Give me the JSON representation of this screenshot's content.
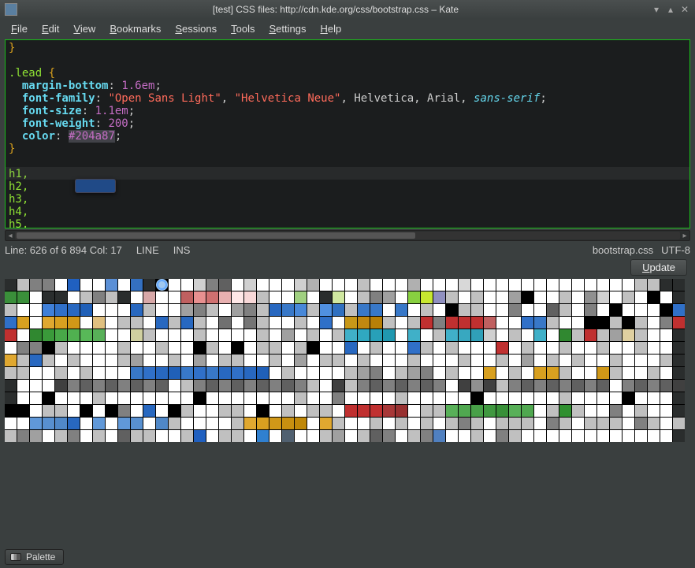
{
  "window": {
    "title": "[test] CSS files: http://cdn.kde.org/css/bootstrap.css – Kate"
  },
  "menu": {
    "items": [
      {
        "ul": "F",
        "rest": "ile"
      },
      {
        "ul": "E",
        "rest": "dit"
      },
      {
        "ul": "V",
        "rest": "iew"
      },
      {
        "ul": "B",
        "rest": "ookmarks"
      },
      {
        "ul": "S",
        "rest": "essions"
      },
      {
        "ul": "T",
        "rest": "ools"
      },
      {
        "ul": "S",
        "rest": "ettings"
      },
      {
        "ul": "H",
        "rest": "elp"
      }
    ]
  },
  "code": {
    "l1_brace": "}",
    "l3_sel": ".lead ",
    "l3_brace": "{",
    "l4_prop": "margin-bottom",
    "l4_val": "1.6em",
    "l5_prop": "font-family",
    "l5_str1": "\"Open Sans Light\"",
    "l5_str2": "\"Helvetica Neue\"",
    "l5_rest": ", Helvetica, Arial, ",
    "l5_kw": "sans-serif",
    "l6_prop": "font-size",
    "l6_val": "1.1em",
    "l7_prop": "font-weight",
    "l7_val": "200",
    "l8_prop": "color",
    "l8_hex": "#204a87",
    "l9_brace": "}",
    "l11": "h1,",
    "l12": "h2,",
    "l13": "h3,",
    "l14": "h4,",
    "l15": "h5,"
  },
  "status": {
    "linecol": "Line: 626 of 6 894 Col: 17",
    "mode1": "LINE",
    "mode2": "INS",
    "filename": "bootstrap.css",
    "encoding": "UTF-8"
  },
  "buttons": {
    "update_ul": "U",
    "update_rest": "pdate"
  },
  "bottom_tab": {
    "label": "Palette"
  },
  "color_tooltip": "#204a87",
  "palette": {
    "selected_row": 0,
    "selected_col": 12,
    "rows": [
      [
        "#2a2d2d",
        "#c0c0c0",
        "#808080",
        "#808080",
        "#ffffff",
        "#2060c0",
        "#ffffff",
        "#ffffff",
        "#5a8fd6",
        "#ffffff",
        "#3470c0",
        "#2a2d2d",
        "#a0c8f0",
        "#ffffff",
        "#ffffff",
        "#d0d0d0",
        "#808080",
        "#606060",
        "#ffffff",
        "#d0d0d0",
        "#ffffff",
        "#ffffff",
        "#ffffff",
        "#d0d0d0",
        "#b0b0b0",
        "#ffffff",
        "#ffffff",
        "#ffffff",
        "#c0c0c0",
        "#ffffff",
        "#ffffff",
        "#ffffff",
        "#b0b0b0",
        "#ffffff",
        "#ffffff",
        "#ffffff",
        "#d8d8d8",
        "#ffffff",
        "#ffffff",
        "#ffffff",
        "#ffffff",
        "#ffffff",
        "#ffffff",
        "#ffffff",
        "#ffffff",
        "#ffffff",
        "#ffffff",
        "#ffffff",
        "#ffffff",
        "#ffffff",
        "#c0c0c0",
        "#c0c0c0",
        "#2a2d2d",
        "#2a2d2d"
      ],
      [
        "#3a8f3a",
        "#3a8f3a",
        "#ffffff",
        "#2a2d2d",
        "#2a2d2d",
        "#ffffff",
        "#c0c0c0",
        "#808080",
        "#c0c0c0",
        "#2a2d2d",
        "#ffffff",
        "#d8a8a8",
        "#ffffff",
        "#ffffff",
        "#c06060",
        "#e89090",
        "#d07070",
        "#e8b0b0",
        "#ffe8e8",
        "#f8d8d8",
        "#c0c0c0",
        "#ffffff",
        "#ffffff",
        "#a0d080",
        "#ffffff",
        "#2a2d2d",
        "#d0e8a0",
        "#ffffff",
        "#c0c0c0",
        "#808080",
        "#a0a0a0",
        "#ffffff",
        "#88d040",
        "#c8e830",
        "#9090c0",
        "#c0c0c0",
        "#ffffff",
        "#c0c0c0",
        "#ffffff",
        "#ffffff",
        "#a0a0a0",
        "#000000",
        "#ffffff",
        "#ffffff",
        "#c0c0c0",
        "#ffffff",
        "#909090",
        "#d0d0d0",
        "#ffffff",
        "#c0c0c0",
        "#ffffff",
        "#000000",
        "#ffffff",
        "#2a2d2d"
      ],
      [
        "#c0c0c0",
        "#ffffff",
        "#ffffff",
        "#4080d8",
        "#3070c8",
        "#2868c0",
        "#2060b8",
        "#ffffff",
        "#ffffff",
        "#ffffff",
        "#2868c0",
        "#c0c0c0",
        "#ffffff",
        "#ffffff",
        "#a0a0a0",
        "#808080",
        "#c0c0c0",
        "#ffffff",
        "#a0a0a0",
        "#808080",
        "#c0c0c0",
        "#2868c0",
        "#3878c8",
        "#4888d8",
        "#c0c0c0",
        "#5090e0",
        "#3070c0",
        "#c0c0c0",
        "#3878c8",
        "#3878c8",
        "#ffffff",
        "#3878c8",
        "#ffffff",
        "#c0c0c0",
        "#ffffff",
        "#000000",
        "#c0c0c0",
        "#c0c0c0",
        "#ffffff",
        "#ffffff",
        "#808080",
        "#ffffff",
        "#ffffff",
        "#606060",
        "#c0c0c0",
        "#ffffff",
        "#808080",
        "#ffffff",
        "#000000",
        "#ffffff",
        "#ffffff",
        "#ffffff",
        "#000000",
        "#3070c8"
      ],
      [
        "#3070c8",
        "#d8a020",
        "#ffffff",
        "#e0a830",
        "#d8a020",
        "#d09818",
        "#ffffff",
        "#e0c080",
        "#ffffff",
        "#c0c0c0",
        "#c0c0c0",
        "#ffffff",
        "#2868c0",
        "#c0c0c0",
        "#2868c0",
        "#c0c0c0",
        "#ffffff",
        "#707070",
        "#ffffff",
        "#757575",
        "#c0c0c0",
        "#ffffff",
        "#ffffff",
        "#c0c0c0",
        "#ffffff",
        "#3070c8",
        "#ffffff",
        "#c89818",
        "#c08810",
        "#b88008",
        "#c0c0c0",
        "#ffffff",
        "#c0c0c0",
        "#c03030",
        "#808080",
        "#c03030",
        "#c03030",
        "#c03030",
        "#c06060",
        "#ffffff",
        "#ffffff",
        "#3070c8",
        "#3878c8",
        "#c0c0c0",
        "#ffffff",
        "#ffffff",
        "#000000",
        "#000000",
        "#c0c0c0",
        "#000000",
        "#c0c0c0",
        "#ffffff",
        "#808080",
        "#c03030"
      ],
      [
        "#c03030",
        "#ffffff",
        "#308830",
        "#3a9a3a",
        "#48a848",
        "#50b050",
        "#58b858",
        "#58b058",
        "#ffffff",
        "#ffffff",
        "#d0d0a0",
        "#c0c0c0",
        "#ffffff",
        "#ffffff",
        "#ffffff",
        "#c0c0c0",
        "#ffffff",
        "#ffffff",
        "#ffffff",
        "#ffffff",
        "#c0c0c0",
        "#ffffff",
        "#a0a0a0",
        "#ffffff",
        "#c0c0c0",
        "#ffffff",
        "#c0c0c0",
        "#40b0c8",
        "#30a8c0",
        "#28a0b8",
        "#2098b0",
        "#ffffff",
        "#40b0c8",
        "#ffffff",
        "#c0c0c0",
        "#40b0c8",
        "#38a8c0",
        "#30a0b8",
        "#d0d0d0",
        "#ffffff",
        "#c0c0c0",
        "#ffffff",
        "#40b0c8",
        "#ffffff",
        "#308830",
        "#c0c0c0",
        "#c03030",
        "#c0c0c0",
        "#a0a0a0",
        "#e0d0a0",
        "#c0c0c0",
        "#ffffff",
        "#ffffff",
        "#2a2d2d"
      ],
      [
        "#ffffff",
        "#808080",
        "#808080",
        "#000000",
        "#c0c0c0",
        "#ffffff",
        "#ffffff",
        "#ffffff",
        "#ffffff",
        "#c0c0c0",
        "#ffffff",
        "#ffffff",
        "#c0c0c0",
        "#ffffff",
        "#ffffff",
        "#000000",
        "#c0c0c0",
        "#ffffff",
        "#000000",
        "#ffffff",
        "#c0c0c0",
        "#c0c0c0",
        "#ffffff",
        "#c0c0c0",
        "#000000",
        "#ffffff",
        "#ffffff",
        "#2868c0",
        "#ffffff",
        "#c0c0c0",
        "#ffffff",
        "#ffffff",
        "#3070c8",
        "#c0c0c0",
        "#ffffff",
        "#c0c0c0",
        "#ffffff",
        "#ffffff",
        "#ffffff",
        "#c03030",
        "#ffffff",
        "#c0c0c0",
        "#ffffff",
        "#ffffff",
        "#c0c0c0",
        "#ffffff",
        "#ffffff",
        "#c0c0c0",
        "#ffffff",
        "#ffffff",
        "#c0c0c0",
        "#ffffff",
        "#ffffff",
        "#2a2d2d"
      ],
      [
        "#e0a830",
        "#c0c0c0",
        "#2868c0",
        "#c0c0c0",
        "#ffffff",
        "#c0c0c0",
        "#ffffff",
        "#ffffff",
        "#ffffff",
        "#c0c0c0",
        "#a0a0a0",
        "#ffffff",
        "#ffffff",
        "#c0c0c0",
        "#ffffff",
        "#a0a0a0",
        "#ffffff",
        "#c0c0c0",
        "#c0c0c0",
        "#ffffff",
        "#ffffff",
        "#c0c0c0",
        "#ffffff",
        "#a0a0a0",
        "#ffffff",
        "#c0c0c0",
        "#c0c0c0",
        "#ffffff",
        "#c0c0c0",
        "#ffffff",
        "#ffffff",
        "#ffffff",
        "#c0c0c0",
        "#ffffff",
        "#ffffff",
        "#ffffff",
        "#c0c0c0",
        "#ffffff",
        "#ffffff",
        "#c0c0c0",
        "#ffffff",
        "#a0a0a0",
        "#ffffff",
        "#c0c0c0",
        "#ffffff",
        "#c0c0c0",
        "#ffffff",
        "#ffffff",
        "#c0c0c0",
        "#ffffff",
        "#ffffff",
        "#ffffff",
        "#c0c0c0",
        "#2a2d2d"
      ],
      [
        "#c0c0c0",
        "#c0c0c0",
        "#ffffff",
        "#ffffff",
        "#c0c0c0",
        "#ffffff",
        "#c0c0c0",
        "#ffffff",
        "#ffffff",
        "#ffffff",
        "#3878c8",
        "#3070c8",
        "#2868c0",
        "#2060b8",
        "#3878c8",
        "#3070c8",
        "#3878c8",
        "#2868c0",
        "#3070c8",
        "#2868c0",
        "#2060b8",
        "#ffffff",
        "#c0c0c0",
        "#ffffff",
        "#ffffff",
        "#ffffff",
        "#ffffff",
        "#c0c0c0",
        "#a0a0a0",
        "#808080",
        "#ffffff",
        "#c0c0c0",
        "#a0a0a0",
        "#808080",
        "#ffffff",
        "#c0c0c0",
        "#ffffff",
        "#ffffff",
        "#d8a020",
        "#ffffff",
        "#c0c0c0",
        "#ffffff",
        "#d8a020",
        "#d8a020",
        "#c0c0c0",
        "#ffffff",
        "#ffffff",
        "#d09818",
        "#c0c0c0",
        "#ffffff",
        "#ffffff",
        "#c0c0c0",
        "#ffffff",
        "#2a2d2d"
      ],
      [
        "#2a2d2d",
        "#ffffff",
        "#ffffff",
        "#ffffff",
        "#404040",
        "#808080",
        "#606060",
        "#808080",
        "#606060",
        "#808080",
        "#606060",
        "#808080",
        "#606060",
        "#ffffff",
        "#c0c0c0",
        "#808080",
        "#606060",
        "#808080",
        "#606060",
        "#808080",
        "#606060",
        "#808080",
        "#606060",
        "#808080",
        "#c0c0c0",
        "#ffffff",
        "#404040",
        "#c0c0c0",
        "#808080",
        "#606060",
        "#808080",
        "#606060",
        "#808080",
        "#606060",
        "#808080",
        "#ffffff",
        "#404040",
        "#909090",
        "#404040",
        "#c0c0c0",
        "#808080",
        "#606060",
        "#808080",
        "#606060",
        "#808080",
        "#606060",
        "#808080",
        "#606060",
        "#ffffff",
        "#808080",
        "#606060",
        "#808080",
        "#606060",
        "#404040"
      ],
      [
        "#2a2d2d",
        "#ffffff",
        "#ffffff",
        "#000000",
        "#ffffff",
        "#ffffff",
        "#ffffff",
        "#c0c0c0",
        "#ffffff",
        "#ffffff",
        "#ffffff",
        "#ffffff",
        "#ffffff",
        "#ffffff",
        "#ffffff",
        "#000000",
        "#ffffff",
        "#ffffff",
        "#ffffff",
        "#ffffff",
        "#ffffff",
        "#ffffff",
        "#ffffff",
        "#c0c0c0",
        "#ffffff",
        "#ffffff",
        "#808080",
        "#ffffff",
        "#ffffff",
        "#ffffff",
        "#ffffff",
        "#c0c0c0",
        "#ffffff",
        "#ffffff",
        "#ffffff",
        "#ffffff",
        "#ffffff",
        "#000000",
        "#ffffff",
        "#ffffff",
        "#ffffff",
        "#ffffff",
        "#ffffff",
        "#ffffff",
        "#c0c0c0",
        "#ffffff",
        "#ffffff",
        "#ffffff",
        "#ffffff",
        "#000000",
        "#ffffff",
        "#ffffff",
        "#ffffff",
        "#2a2d2d"
      ],
      [
        "#000000",
        "#000000",
        "#ffffff",
        "#c0c0c0",
        "#c0c0c0",
        "#ffffff",
        "#000000",
        "#ffffff",
        "#000000",
        "#808080",
        "#ffffff",
        "#2868c0",
        "#ffffff",
        "#000000",
        "#c0c0c0",
        "#ffffff",
        "#ffffff",
        "#c0c0c0",
        "#c0c0c0",
        "#ffffff",
        "#000000",
        "#ffffff",
        "#c0c0c0",
        "#ffffff",
        "#c0c0c0",
        "#c0c0c0",
        "#ffffff",
        "#c03030",
        "#c03030",
        "#c03030",
        "#a83838",
        "#983030",
        "#ffffff",
        "#c0c0c0",
        "#c0c0c0",
        "#58b058",
        "#50a850",
        "#48a048",
        "#409840",
        "#389038",
        "#58b058",
        "#50a850",
        "#ffffff",
        "#c0c0c0",
        "#309030",
        "#c0c0c0",
        "#ffffff",
        "#ffffff",
        "#808080",
        "#ffffff",
        "#c0c0c0",
        "#ffffff",
        "#ffffff",
        "#2a2d2d"
      ],
      [
        "#ffffff",
        "#ffffff",
        "#6098d8",
        "#5890d0",
        "#5088c8",
        "#2868c0",
        "#ffffff",
        "#6098d8",
        "#ffffff",
        "#6098d8",
        "#5890d0",
        "#ffffff",
        "#5088c8",
        "#c0c0c0",
        "#ffffff",
        "#ffffff",
        "#ffffff",
        "#ffffff",
        "#c0c0c0",
        "#e0a830",
        "#d8a020",
        "#d09818",
        "#c89010",
        "#c08808",
        "#ffffff",
        "#e0a830",
        "#c0c0c0",
        "#ffffff",
        "#ffffff",
        "#c0c0c0",
        "#ffffff",
        "#c0c0c0",
        "#ffffff",
        "#c0c0c0",
        "#ffffff",
        "#c0c0c0",
        "#808080",
        "#c0c0c0",
        "#ffffff",
        "#c0c0c0",
        "#c0c0c0",
        "#c0c0c0",
        "#ffffff",
        "#808080",
        "#c0c0c0",
        "#ffffff",
        "#c0c0c0",
        "#c0c0c0",
        "#c0c0c0",
        "#ffffff",
        "#808080",
        "#c0c0c0",
        "#ffffff",
        "#c0c0c0"
      ],
      [
        "#c0c0c0",
        "#808080",
        "#a0a0a0",
        "#ffffff",
        "#c0c0c0",
        "#808080",
        "#ffffff",
        "#c0c0c0",
        "#ffffff",
        "#606060",
        "#c0c0c0",
        "#c0c0c0",
        "#ffffff",
        "#ffffff",
        "#c0c0c0",
        "#2060c0",
        "#ffffff",
        "#c0c0c0",
        "#c0c0c0",
        "#ffffff",
        "#3080d0",
        "#ffffff",
        "#506070",
        "#ffffff",
        "#ffffff",
        "#c0c0c0",
        "#a0a0a0",
        "#ffffff",
        "#c0c0c0",
        "#606060",
        "#808080",
        "#ffffff",
        "#c0c0c0",
        "#808080",
        "#5080c0",
        "#ffffff",
        "#ffffff",
        "#c0c0c0",
        "#ffffff",
        "#808080",
        "#c0c0c0",
        "#ffffff",
        "#ffffff",
        "#ffffff",
        "#ffffff",
        "#ffffff",
        "#ffffff",
        "#ffffff",
        "#ffffff",
        "#ffffff",
        "#ffffff",
        "#ffffff",
        "#ffffff",
        "#2a2d2d"
      ]
    ]
  }
}
